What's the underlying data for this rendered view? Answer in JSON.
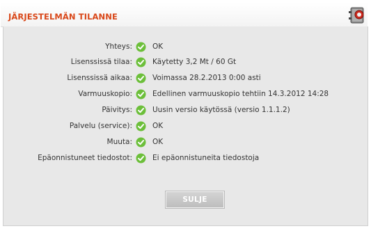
{
  "dialog": {
    "title": "JÄRJESTELMÄN TILANNE",
    "close_label": "SULJE"
  },
  "status_rows": [
    {
      "label": "Yhteys:",
      "value": "OK",
      "icon": "check-icon"
    },
    {
      "label": "Lisenssissä tilaa:",
      "value": "Käytetty 3,2 Mt / 60 Gt",
      "icon": "check-icon"
    },
    {
      "label": "Lisenssissä aikaa:",
      "value": "Voimassa 28.2.2013 0:00 asti",
      "icon": "check-icon"
    },
    {
      "label": "Varmuuskopio:",
      "value": "Edellinen varmuuskopio tehtiin 14.3.2012 14:28",
      "icon": "check-icon"
    },
    {
      "label": "Päivitys:",
      "value": "Uusin versio käytössä (versio 1.1.1.2)",
      "icon": "check-icon"
    },
    {
      "label": "Palvelu (service):",
      "value": "OK",
      "icon": "check-icon"
    },
    {
      "label": "Muuta:",
      "value": "OK",
      "icon": "check-icon"
    },
    {
      "label": "Epäonnistuneet tiedostot:",
      "value": "Ei epäonnistuneita tiedostoja",
      "icon": "check-icon"
    }
  ],
  "colors": {
    "title": "#d9481a",
    "check": "#6cbf3a",
    "panel_bg": "#e8e8e8"
  }
}
